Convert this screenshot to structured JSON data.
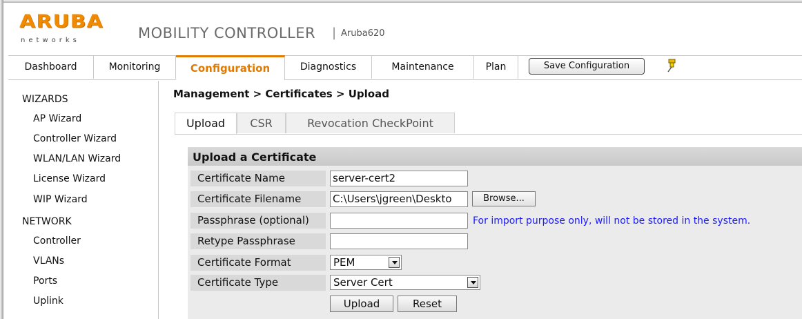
{
  "header": {
    "logo_text": "ARUBA",
    "logo_sub": "networks",
    "app_title": "MOBILITY CONTROLLER",
    "separator": "|",
    "device": "Aruba620"
  },
  "nav": {
    "tabs": [
      "Dashboard",
      "Monitoring",
      "Configuration",
      "Diagnostics",
      "Maintenance",
      "Plan"
    ],
    "active": "Configuration",
    "save_label": "Save Configuration",
    "pin_icon": "pin-icon"
  },
  "sidebar": {
    "wizards_label": "WIZARDS",
    "wizards": [
      "AP Wizard",
      "Controller Wizard",
      "WLAN/LAN Wizard",
      "License Wizard",
      "WIP Wizard"
    ],
    "network_label": "NETWORK",
    "network": [
      "Controller",
      "VLANs",
      "Ports",
      "Uplink"
    ]
  },
  "main": {
    "breadcrumb": "Management > Certificates > Upload",
    "subtabs": [
      "Upload",
      "CSR",
      "Revocation CheckPoint"
    ],
    "active_subtab": "Upload",
    "panel_title": "Upload a Certificate",
    "fields": {
      "cert_name_label": "Certificate Name",
      "cert_name_value": "server-cert2",
      "cert_file_label": "Certificate Filename",
      "cert_file_value": "C:\\Users\\jgreen\\Deskto",
      "browse_label": "Browse...",
      "passphrase_label": "Passphrase (optional)",
      "passphrase_value": "",
      "passphrase_hint": "For import purpose only, will not be stored in the system.",
      "retype_label": "Retype Passphrase",
      "retype_value": "",
      "format_label": "Certificate Format",
      "format_value": "PEM",
      "type_label": "Certificate Type",
      "type_value": "Server Cert"
    },
    "upload_label": "Upload",
    "reset_label": "Reset"
  },
  "colors": {
    "accent": "#e07a00",
    "logo": "#f08a00",
    "hint": "#1a1aff"
  }
}
